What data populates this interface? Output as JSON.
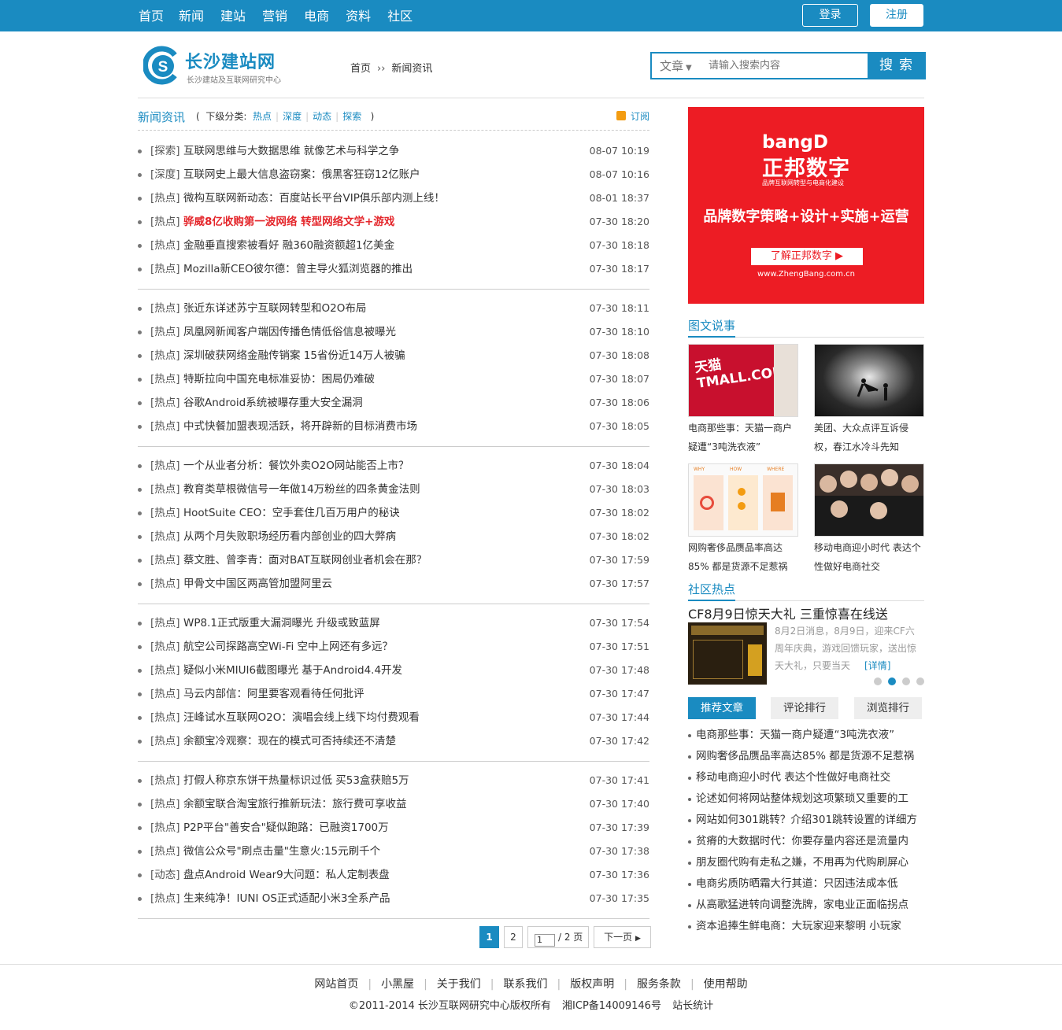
{
  "topnav": [
    "首页",
    "新闻",
    "建站",
    "营销",
    "电商",
    "资料",
    "社区"
  ],
  "auth": {
    "login": "登录",
    "register": "注册"
  },
  "logo": {
    "title": "长沙建站网",
    "subtitle": "长沙建站及互联网研究中心"
  },
  "breadcrumb": {
    "home": "首页",
    "sep": "››",
    "current": "新闻资讯"
  },
  "search": {
    "category": "文章",
    "placeholder": "请输入搜索内容",
    "button": "搜索"
  },
  "section": {
    "title": "新闻资讯",
    "sub_label": "下级分类:",
    "open": "(",
    "close": ")",
    "sub_cats": [
      "热点",
      "深度",
      "动态",
      "探索"
    ],
    "rss": "订阅"
  },
  "news_groups": [
    [
      {
        "cat": "[探索]",
        "title": "互联网思维与大数据思维 就像艺术与科学之争",
        "time": "08-07 10:19"
      },
      {
        "cat": "[深度]",
        "title": "互联网史上最大信息盗窃案：俄黑客狂窃12亿账户",
        "time": "08-07 10:16"
      },
      {
        "cat": "[热点]",
        "title": "微构互联网新动态：百度站长平台VIP俱乐部内测上线！",
        "time": "08-01 18:37"
      },
      {
        "cat": "[热点]",
        "title": "骅威8亿收购第一波网络 转型网络文学+游戏",
        "time": "07-30 18:20",
        "red": true
      },
      {
        "cat": "[热点]",
        "title": "金融垂直搜索被看好 融360融资额超1亿美金",
        "time": "07-30 18:18"
      },
      {
        "cat": "[热点]",
        "title": "Mozilla新CEO彼尔德：曾主导火狐浏览器的推出",
        "time": "07-30 18:17"
      }
    ],
    [
      {
        "cat": "[热点]",
        "title": "张近东详述苏宁互联网转型和O2O布局",
        "time": "07-30 18:11"
      },
      {
        "cat": "[热点]",
        "title": "凤凰网新闻客户端因传播色情低俗信息被曝光",
        "time": "07-30 18:10"
      },
      {
        "cat": "[热点]",
        "title": "深圳破获网络金融传销案 15省份近14万人被骗",
        "time": "07-30 18:08"
      },
      {
        "cat": "[热点]",
        "title": "特斯拉向中国充电标准妥协：困局仍难破",
        "time": "07-30 18:07"
      },
      {
        "cat": "[热点]",
        "title": "谷歌Android系统被曝存重大安全漏洞",
        "time": "07-30 18:06"
      },
      {
        "cat": "[热点]",
        "title": "中式快餐加盟表现活跃，将开辟新的目标消费市场",
        "time": "07-30 18:05"
      }
    ],
    [
      {
        "cat": "[热点]",
        "title": "一个从业者分析：餐饮外卖O2O网站能否上市？",
        "time": "07-30 18:04"
      },
      {
        "cat": "[热点]",
        "title": "教育类草根微信号一年做14万粉丝的四条黄金法则",
        "time": "07-30 18:03"
      },
      {
        "cat": "[热点]",
        "title": "HootSuite CEO：空手套住几百万用户的秘诀",
        "time": "07-30 18:02"
      },
      {
        "cat": "[热点]",
        "title": "从两个月失败职场经历看内部创业的四大弊病",
        "time": "07-30 18:02"
      },
      {
        "cat": "[热点]",
        "title": "蔡文胜、曾李青：面对BAT互联网创业者机会在那？",
        "time": "07-30 17:59"
      },
      {
        "cat": "[热点]",
        "title": "甲骨文中国区两高管加盟阿里云",
        "time": "07-30 17:57"
      }
    ],
    [
      {
        "cat": "[热点]",
        "title": "WP8.1正式版重大漏洞曝光 升级或致蓝屏",
        "time": "07-30 17:54"
      },
      {
        "cat": "[热点]",
        "title": "航空公司探路高空Wi-Fi 空中上网还有多远？",
        "time": "07-30 17:51"
      },
      {
        "cat": "[热点]",
        "title": "疑似小米MIUI6截图曝光 基于Android4.4开发",
        "time": "07-30 17:48"
      },
      {
        "cat": "[热点]",
        "title": "马云内部信：阿里要客观看待任何批评",
        "time": "07-30 17:47"
      },
      {
        "cat": "[热点]",
        "title": "汪峰试水互联网O2O：演唱会线上线下均付费观看",
        "time": "07-30 17:44"
      },
      {
        "cat": "[热点]",
        "title": "余额宝冷观察：现在的模式可否持续还不清楚",
        "time": "07-30 17:42"
      }
    ],
    [
      {
        "cat": "[热点]",
        "title": "打假人称京东饼干热量标识过低 买53盒获赔5万",
        "time": "07-30 17:41"
      },
      {
        "cat": "[热点]",
        "title": "余额宝联合淘宝旅行推新玩法：旅行费可享收益",
        "time": "07-30 17:40"
      },
      {
        "cat": "[热点]",
        "title": "P2P平台\"善安合\"疑似跑路：已融资1700万",
        "time": "07-30 17:39"
      },
      {
        "cat": "[热点]",
        "title": "微信公众号\"刷点击量\"生意火:15元刷千个",
        "time": "07-30 17:38"
      },
      {
        "cat": "[动态]",
        "title": "盘点Android Wear9大问题：私人定制表盘",
        "time": "07-30 17:36"
      },
      {
        "cat": "[热点]",
        "title": "生来纯净！IUNI OS正式适配小米3全系产品",
        "time": "07-30 17:35"
      }
    ]
  ],
  "pager": {
    "current": "1",
    "page2": "2",
    "jump_value": "1",
    "total": "/ 2 页",
    "next": "下一页"
  },
  "ad": {
    "brand_en": "bangD",
    "brand_cn": "正邦数字",
    "brand_tag": "品牌互联网转型与电商化建设",
    "slogan": "品牌数字策略+设计+实施+运营",
    "button": "了解正邦数字 ▶",
    "url": "www.ZhengBang.com.cn"
  },
  "pic_section": {
    "title": "图文说事",
    "items": [
      {
        "caption": "电商那些事：天猫一商户疑遭“3吨洗衣液”",
        "img_text": "天猫 TMALL.COM"
      },
      {
        "caption": "美团、大众点评互诉侵权，春江水冷斗先知"
      },
      {
        "caption": "网购奢侈品赝品率高达85% 都是货源不足惹祸",
        "img_text": "WHY HOW WHERE"
      },
      {
        "caption": "移动电商迎小时代 表达个性做好电商社交"
      }
    ]
  },
  "hot_section": {
    "title": "社区热点",
    "headline": "CF8月9日惊天大礼 三重惊喜在线送",
    "summary": "8月2日消息，8月9日，迎来CF六周年庆典，游戏回馈玩家，送出惊天大礼，只要当天",
    "more": "[详情]"
  },
  "tabs": [
    "推荐文章",
    "评论排行",
    "浏览排行"
  ],
  "rank_list": [
    "电商那些事：天猫一商户疑遭“3吨洗衣液”",
    "网购奢侈品赝品率高达85% 都是货源不足惹祸",
    "移动电商迎小时代 表达个性做好电商社交",
    "论述如何将网站整体规划这项繁琐又重要的工",
    "网站如何301跳转？介绍301跳转设置的详细方",
    "贫瘠的大数据时代：你要存量内容还是流量内",
    "朋友圈代购有走私之嫌，不用再为代购刷屏心",
    "电商劣质防晒霜大行其道：只因违法成本低",
    "从高歌猛进转向调整洗牌，家电业正面临拐点",
    "资本追捧生鲜电商：大玩家迎来黎明 小玩家"
  ],
  "footer": {
    "links": [
      "网站首页",
      "小黑屋",
      "关于我们",
      "联系我们",
      "版权声明",
      "服务条款",
      "使用帮助"
    ],
    "copyright": "©2011-2014 长沙互联网研究中心版权所有",
    "icp": "湘ICP备14009146号",
    "stats": "站长统计"
  },
  "colors": {
    "accent": "#1a8bc1",
    "ad_red": "#ed1c24",
    "headline_red": "#e4262b"
  }
}
